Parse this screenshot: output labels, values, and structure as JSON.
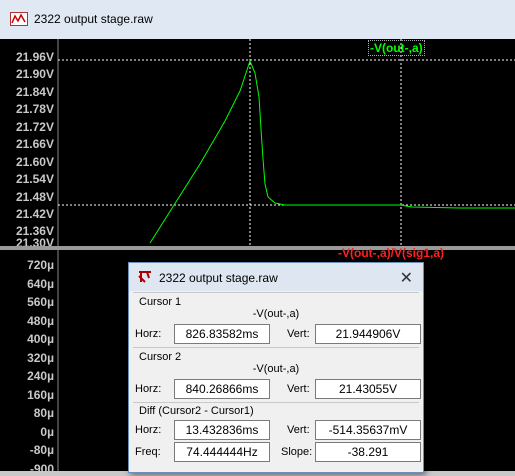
{
  "window": {
    "title": "2322 output stage.raw",
    "icon": "waveform-app-icon"
  },
  "pane1": {
    "trace_label": "-V(out-,a)",
    "trace_color": "#00ff00",
    "y_ticks": [
      "21.96V",
      "21.90V",
      "21.84V",
      "21.78V",
      "21.72V",
      "21.66V",
      "21.60V",
      "21.54V",
      "21.48V",
      "21.42V",
      "21.36V",
      "21.30V"
    ]
  },
  "pane2": {
    "trace_label": "-V(out-,a)/V(sig1,a)",
    "trace_color": "#ff2020",
    "y_ticks": [
      "720µ",
      "640µ",
      "560µ",
      "480µ",
      "400µ",
      "320µ",
      "240µ",
      "160µ",
      "80µ",
      "0µ",
      "-80µ",
      "-900"
    ]
  },
  "dialog": {
    "title": "2322 output stage.raw",
    "close_symbol": "✕",
    "cursor1": {
      "title": "Cursor 1",
      "trace": "-V(out-,a)",
      "horz_label": "Horz:",
      "horz": "826.83582ms",
      "vert_label": "Vert:",
      "vert": "21.944906V"
    },
    "cursor2": {
      "title": "Cursor 2",
      "trace": "-V(out-,a)",
      "horz_label": "Horz:",
      "horz": "840.26866ms",
      "vert_label": "Vert:",
      "vert": "21.43055V"
    },
    "diff": {
      "title": "Diff (Cursor2 - Cursor1)",
      "horz_label": "Horz:",
      "horz": "13.432836ms",
      "vert_label": "Vert:",
      "vert": "-514.35637mV",
      "freq_label": "Freq:",
      "freq": "74.444444Hz",
      "slope_label": "Slope:",
      "slope": "-38.291"
    }
  }
}
